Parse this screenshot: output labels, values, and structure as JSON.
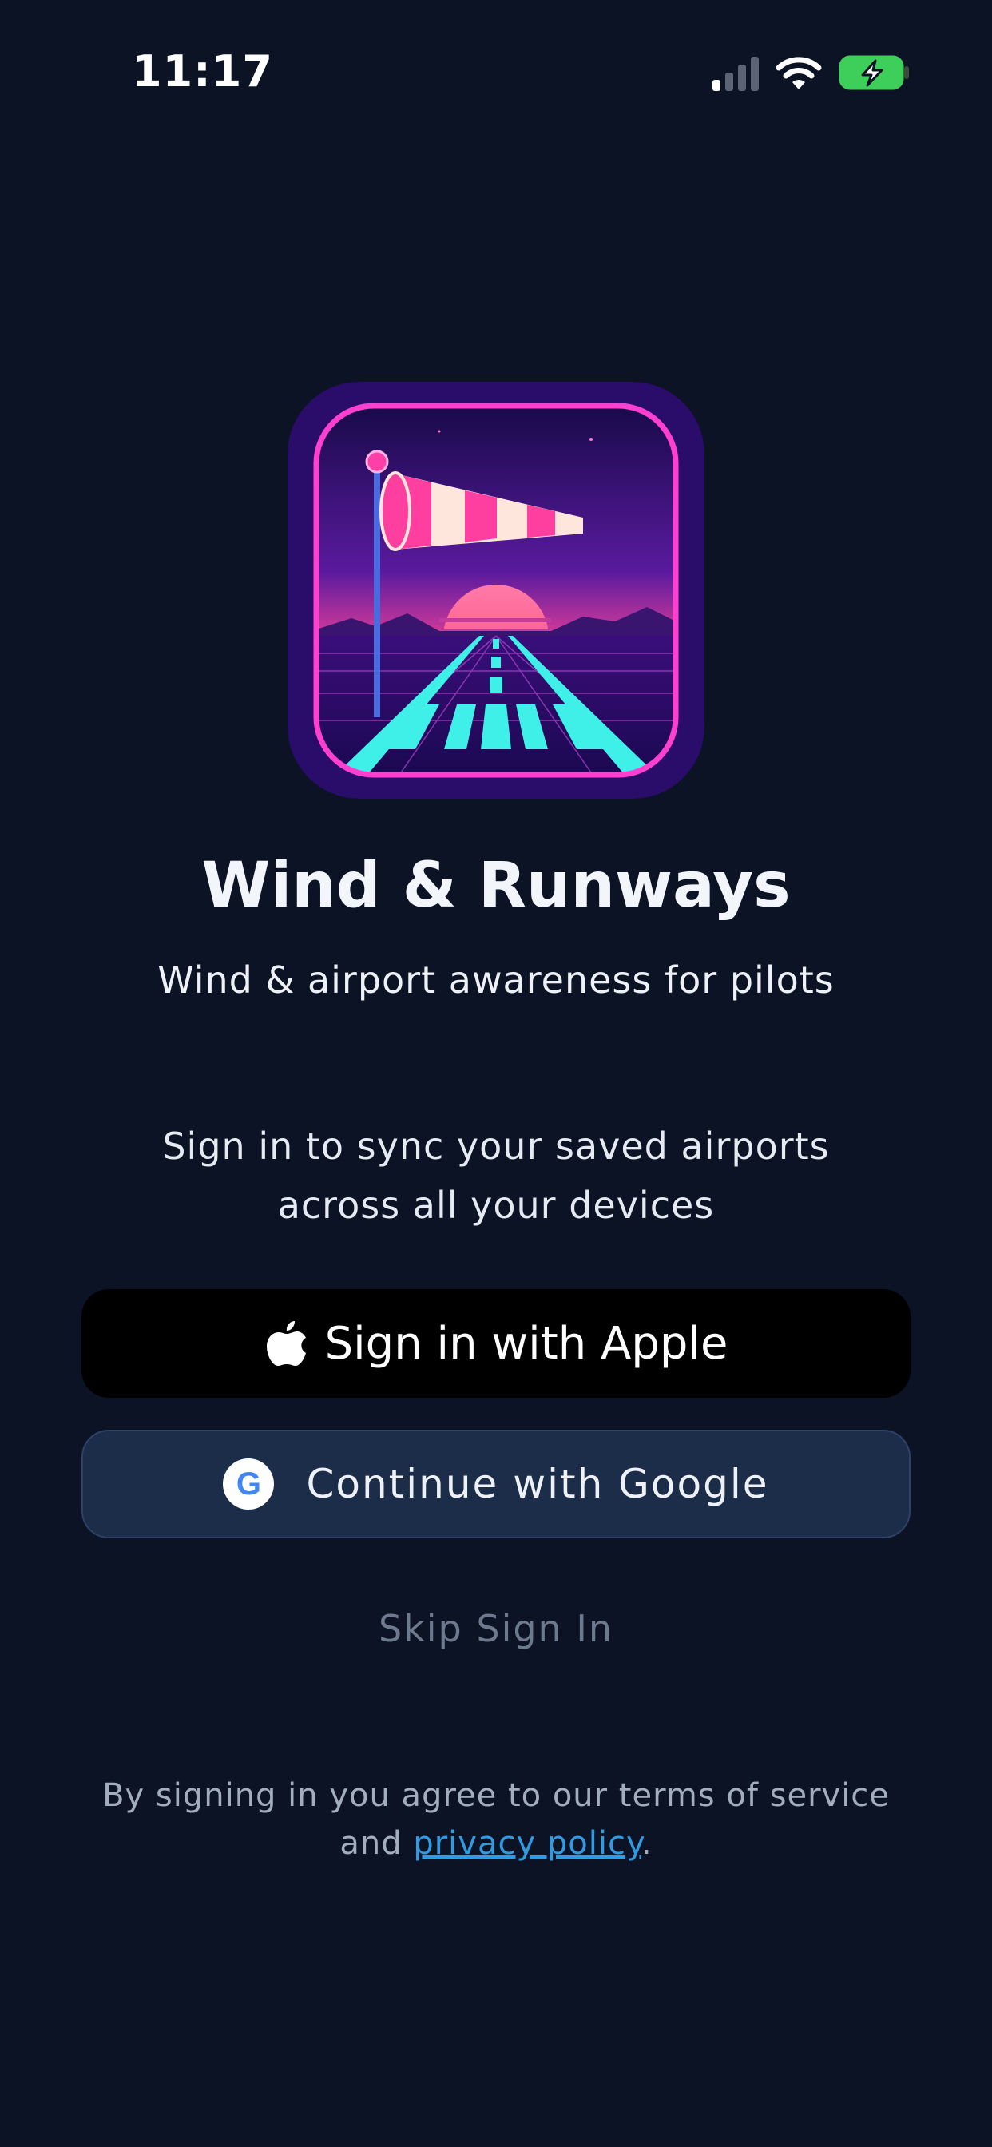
{
  "status_bar": {
    "time": "11:17",
    "icons": [
      "signal-icon",
      "wifi-icon",
      "battery-charging-icon"
    ]
  },
  "app": {
    "icon": "windsock-runway-icon",
    "title": "Wind & Runways",
    "subtitle": "Wind & airport awareness for pilots"
  },
  "sync_text": {
    "line1": "Sign in to sync your saved airports",
    "line2": "across all your devices"
  },
  "buttons": {
    "apple": {
      "icon": "apple-logo-icon",
      "label": "Sign in with Apple"
    },
    "google": {
      "icon": "google-logo-icon",
      "icon_letter": "G",
      "label": "Continue with Google"
    },
    "skip": {
      "label": "Skip Sign In"
    }
  },
  "terms": {
    "prefix": "By signing in you agree to our terms of service",
    "and": "and",
    "link": "privacy policy",
    "suffix": "."
  },
  "colors": {
    "background": "#0b1324",
    "apple_button": "#000000",
    "google_button": "#1b2d49",
    "link": "#2f9be3",
    "skip_text": "#6d7a8e"
  }
}
